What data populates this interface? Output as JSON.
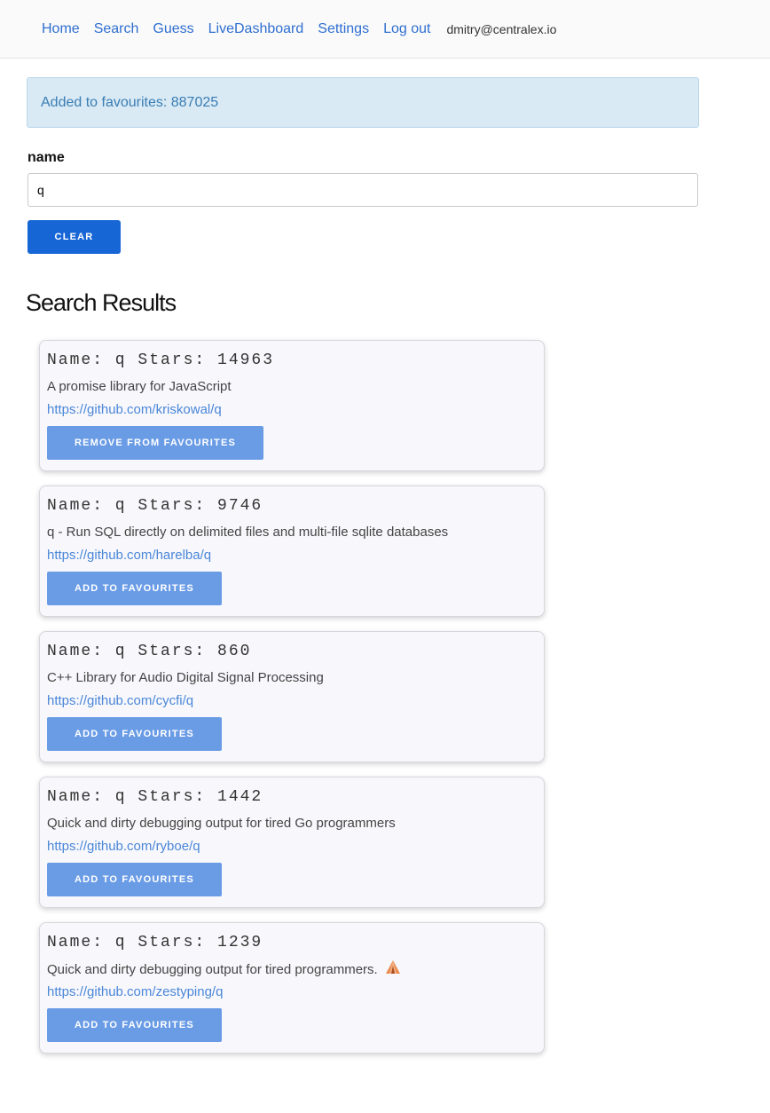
{
  "nav": {
    "items": [
      "Home",
      "Search",
      "Guess",
      "LiveDashboard",
      "Settings",
      "Log out"
    ],
    "user_email": "dmitry@centralex.io"
  },
  "flash": {
    "message": "Added to favourites: 887025"
  },
  "search": {
    "label": "name",
    "value": "q",
    "clear_label": "CLEAR"
  },
  "results": {
    "title": "Search Results",
    "items": [
      {
        "title": "Name: q Stars: 14963",
        "description": "A promise library for JavaScript",
        "url": "https://github.com/kriskowal/q",
        "button": "REMOVE FROM FAVOURITES"
      },
      {
        "title": "Name: q Stars: 9746",
        "description": "q - Run SQL directly on delimited files and multi-file sqlite databases",
        "url": "https://github.com/harelba/q",
        "button": "ADD TO FAVOURITES"
      },
      {
        "title": "Name: q Stars: 860",
        "description": "C++ Library for Audio Digital Signal Processing",
        "url": "https://github.com/cycfi/q",
        "button": "ADD TO FAVOURITES"
      },
      {
        "title": "Name: q Stars: 1442",
        "description": "Quick and dirty debugging output for tired Go programmers",
        "url": "https://github.com/ryboe/q",
        "button": "ADD TO FAVOURITES"
      },
      {
        "title": "Name: q Stars: 1239",
        "description": "Quick and dirty debugging output for tired programmers.",
        "url": "https://github.com/zestyping/q",
        "button": "ADD TO FAVOURITES",
        "icon": "tent-icon"
      }
    ]
  }
}
